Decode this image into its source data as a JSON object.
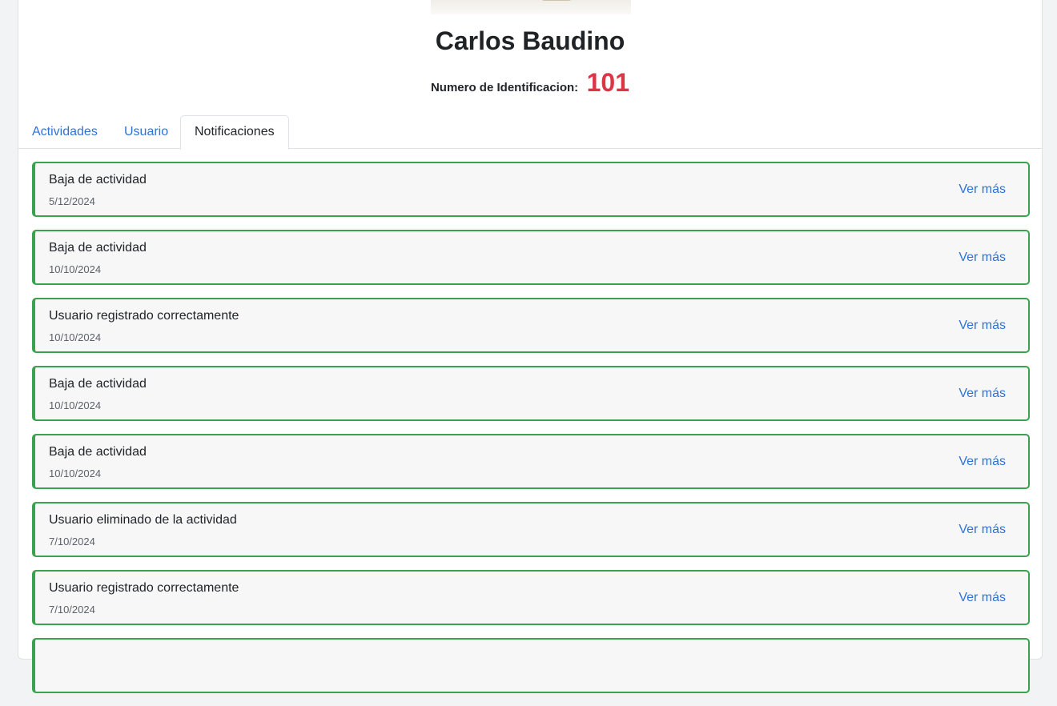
{
  "profile": {
    "name": "Carlos Baudino",
    "id_label": "Numero de Identificacion:",
    "id_value": "101"
  },
  "tabs": [
    {
      "label": "Actividades",
      "active": false
    },
    {
      "label": "Usuario",
      "active": false
    },
    {
      "label": "Notificaciones",
      "active": true
    }
  ],
  "notifications": [
    {
      "title": "Baja de actividad",
      "date": "5/12/2024",
      "link": "Ver más"
    },
    {
      "title": "Baja de actividad",
      "date": "10/10/2024",
      "link": "Ver más"
    },
    {
      "title": "Usuario registrado correctamente",
      "date": "10/10/2024",
      "link": "Ver más"
    },
    {
      "title": "Baja de actividad",
      "date": "10/10/2024",
      "link": "Ver más"
    },
    {
      "title": "Baja de actividad",
      "date": "10/10/2024",
      "link": "Ver más"
    },
    {
      "title": "Usuario eliminado de la actividad",
      "date": "7/10/2024",
      "link": "Ver más"
    },
    {
      "title": "Usuario registrado correctamente",
      "date": "7/10/2024",
      "link": "Ver más"
    }
  ],
  "colors": {
    "accent": "#2f72d6",
    "id_value": "#dc3545",
    "notification_border": "#3aa14f",
    "notification_bg": "#f7f7f8"
  }
}
